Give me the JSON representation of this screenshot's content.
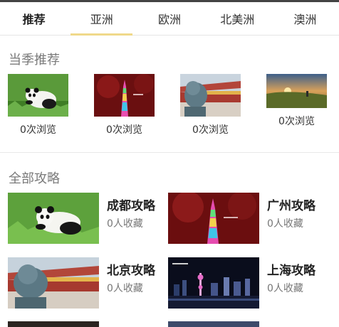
{
  "tabs": [
    {
      "label": "推荐"
    },
    {
      "label": "亚洲"
    },
    {
      "label": "欧洲"
    },
    {
      "label": "北美洲"
    },
    {
      "label": "澳洲"
    }
  ],
  "season": {
    "title": "当季推荐",
    "items": [
      {
        "views": "0次浏览"
      },
      {
        "views": "0次浏览"
      },
      {
        "views": "0次浏览"
      },
      {
        "views": "0次浏览"
      }
    ]
  },
  "all_guides": {
    "title": "全部攻略",
    "items": [
      {
        "title": "成都攻略",
        "favorites": "0人收藏"
      },
      {
        "title": "广州攻略",
        "favorites": "0人收藏"
      },
      {
        "title": "北京攻略",
        "favorites": "0人收藏"
      },
      {
        "title": "上海攻略",
        "favorites": "0人收藏"
      }
    ]
  },
  "colors": {
    "active_tab_underline": "#f0d98a",
    "section_title": "#7a7a7a"
  }
}
